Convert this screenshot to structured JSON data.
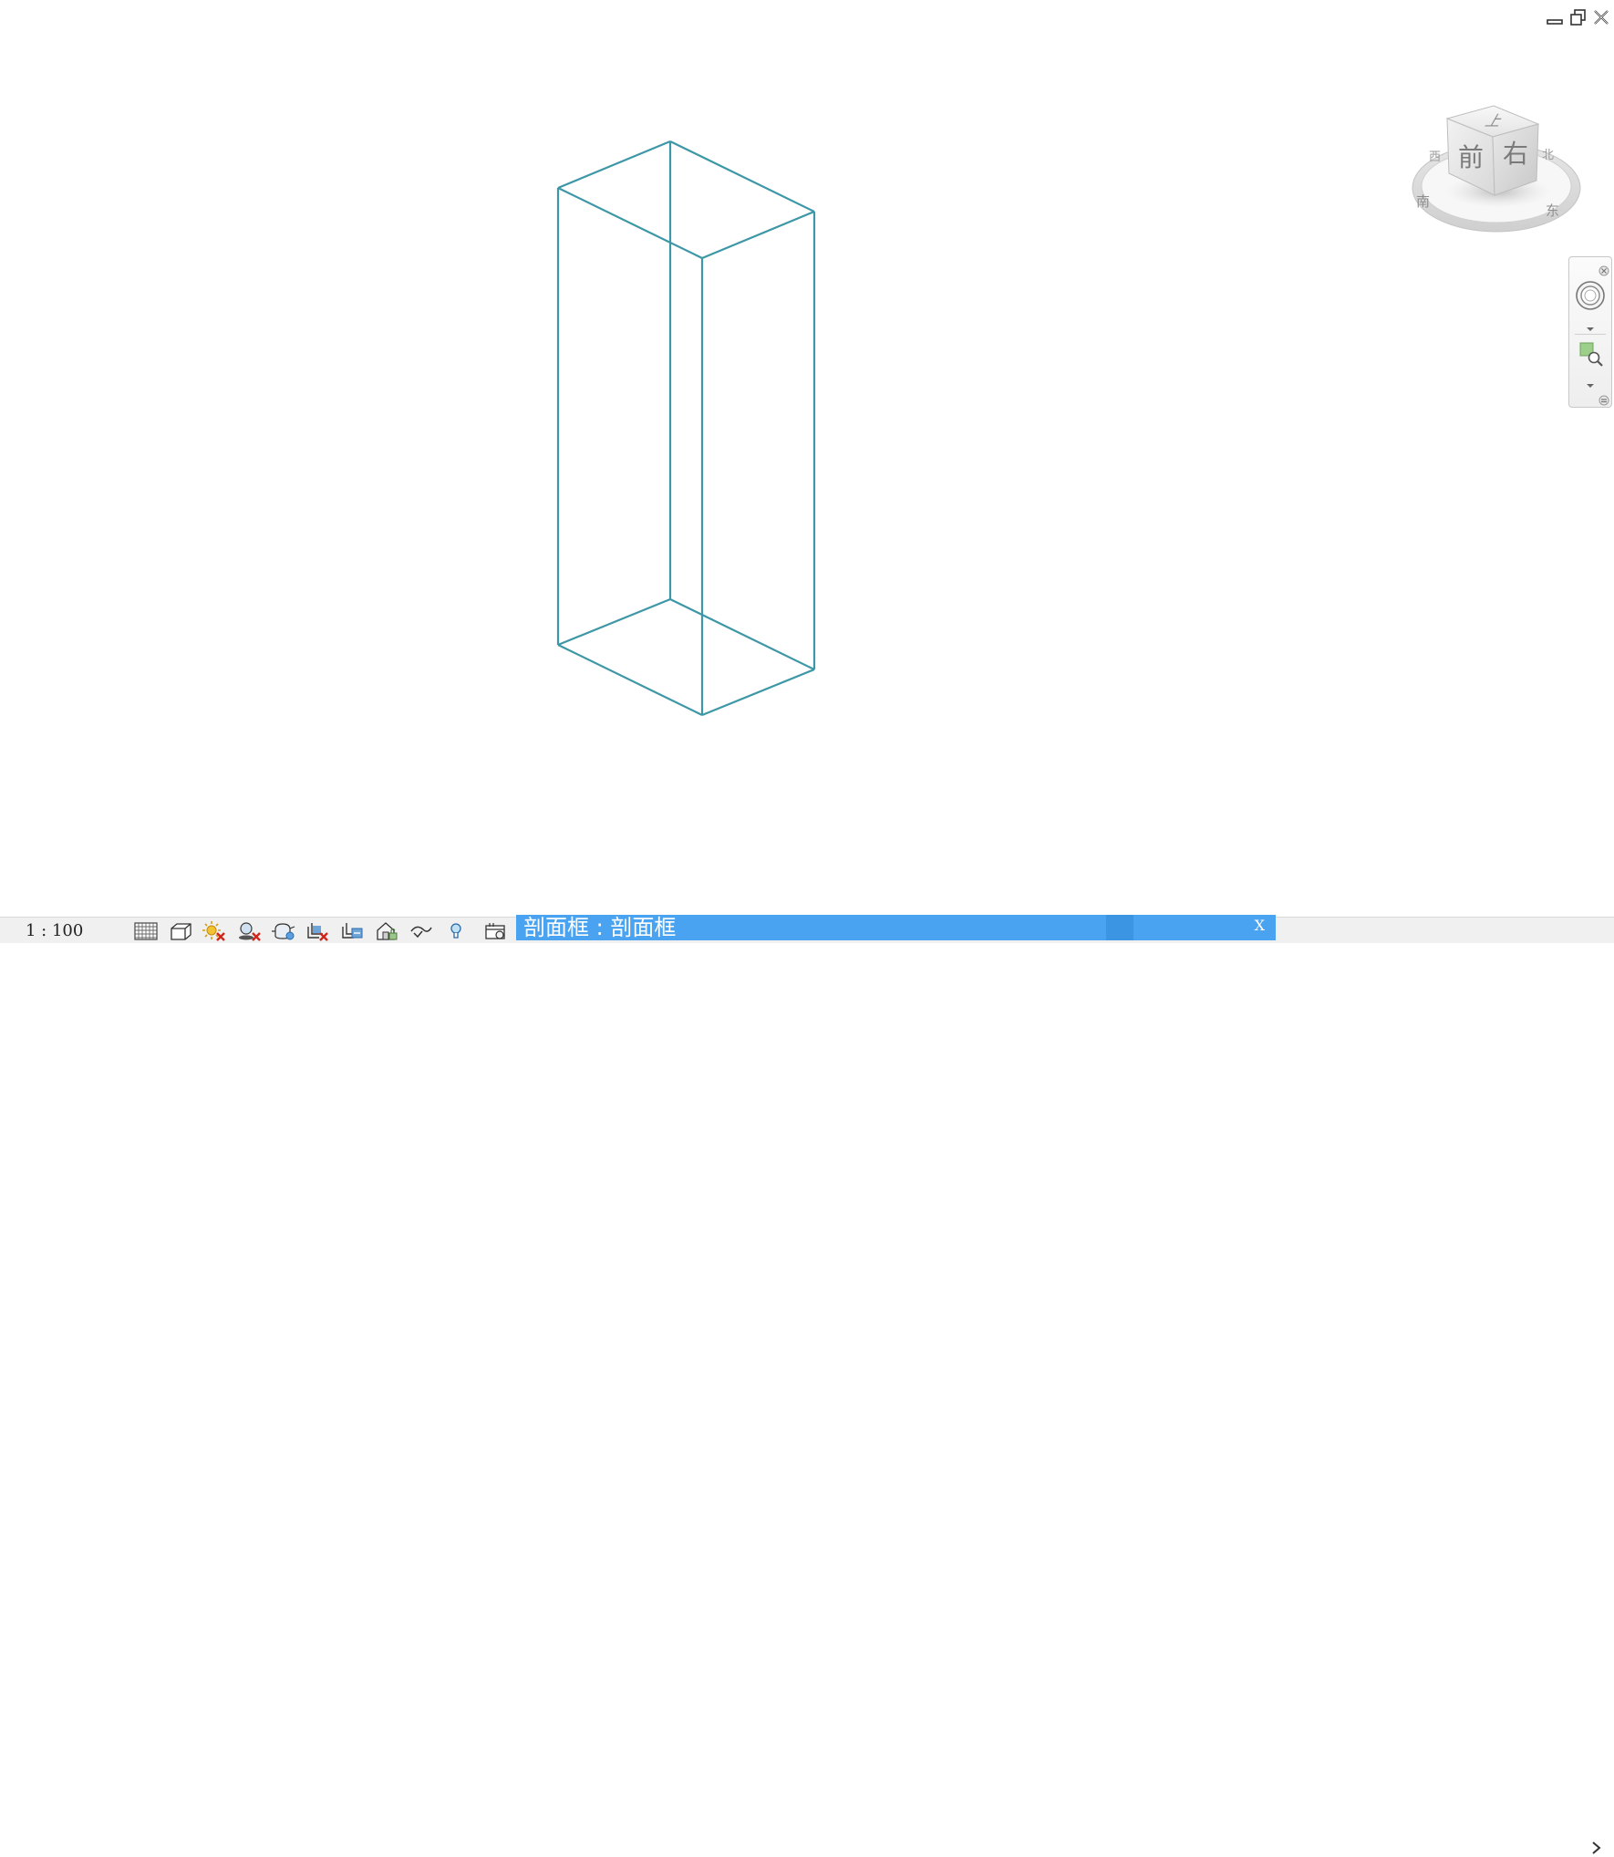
{
  "viewport": {
    "section_box_color": "#3e97a6"
  },
  "window_controls": {
    "minimize_icon": "minimize-icon",
    "restore_icon": "restore-icon",
    "close_icon": "close-icon"
  },
  "view_cube": {
    "face_top": "上",
    "face_front": "前",
    "face_right": "右",
    "compass_north": "北",
    "compass_east": "东",
    "compass_south": "南",
    "compass_west": "西"
  },
  "nav_bar": {
    "items": [
      "full-navigation-wheel-icon",
      "zoom-region-icon"
    ]
  },
  "status_bar": {
    "scale": "1 : 100",
    "icons": [
      "detail-level-icon",
      "visual-style-icon",
      "sun-path-off-icon",
      "shadows-off-icon",
      "rendering-dialog-icon",
      "crop-view-off-icon",
      "show-crop-region-icon",
      "unlocked-3d-view-icon",
      "temporary-hide-isolate-icon",
      "reveal-hidden-elements-icon",
      "temporary-view-properties-icon"
    ],
    "tooltip_text": "剖面框 : 剖面框",
    "tooltip_close": "X",
    "tooltip_color": "#4aa3f0"
  }
}
